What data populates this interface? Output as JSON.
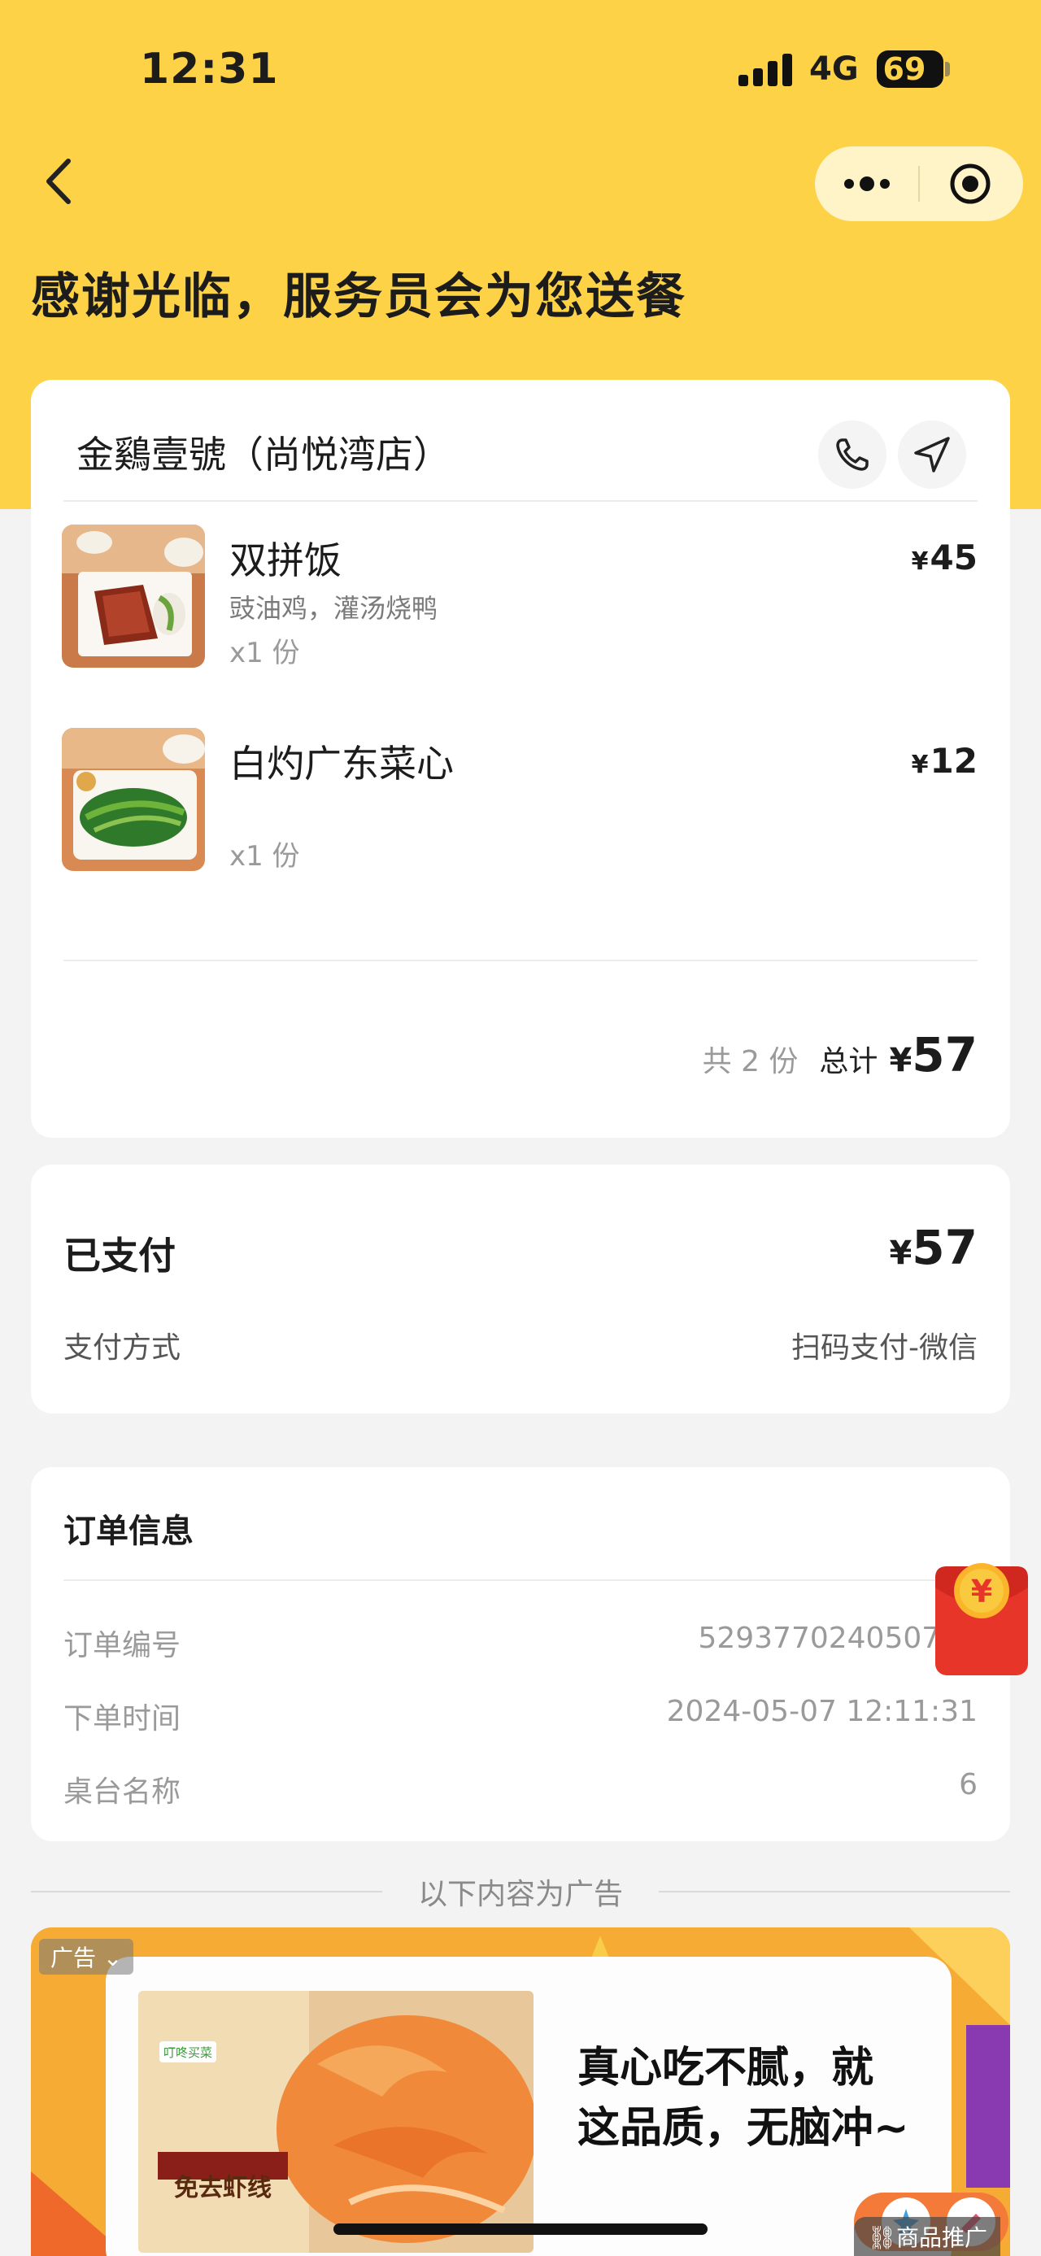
{
  "status_bar": {
    "time": "12:31",
    "network": "4G",
    "battery": "69",
    "battery_level": 0.69
  },
  "header": {
    "title": "感谢光临，服务员会为您送餐"
  },
  "store": {
    "name": "金鷄壹號（尚悦湾店）"
  },
  "order_items": [
    {
      "name": "双拼饭",
      "desc": "豉油鸡，灌汤烧鸭",
      "qty": "x1 份",
      "currency": "¥",
      "price": "45"
    },
    {
      "name": "白灼广东菜心",
      "desc": "",
      "qty": "x1 份",
      "currency": "¥",
      "price": "12"
    }
  ],
  "summary": {
    "count": "共 2 份",
    "total_label": "总计",
    "currency": "¥",
    "total": "57"
  },
  "payment": {
    "title": "已支付",
    "currency": "¥",
    "amount": "57",
    "method_label": "支付方式",
    "method_value": "扫码支付-微信"
  },
  "order_info": {
    "title": "订单信息",
    "rows": [
      {
        "label": "订单编号",
        "value": "529377024050700"
      },
      {
        "label": "下单时间",
        "value": "2024-05-07 12:11:31"
      },
      {
        "label": "桌台名称",
        "value": "6"
      }
    ]
  },
  "ad": {
    "separator": "以下内容为广告",
    "tag": "广告",
    "line1": "真心吃不腻，就",
    "line2": "这品质，无脑冲~",
    "promo_tag": "商品推广",
    "product_brand": "叮咚买菜",
    "product_title": "免去虾线"
  },
  "colors": {
    "brand_yellow": "#fdd246",
    "card": "#ffffff",
    "page_bg": "#f3f3f3",
    "red_packet": "#e8352a"
  },
  "icons": [
    "back-icon",
    "more-icon",
    "close-target-icon",
    "phone-icon",
    "navigate-icon",
    "red-packet-icon"
  ]
}
